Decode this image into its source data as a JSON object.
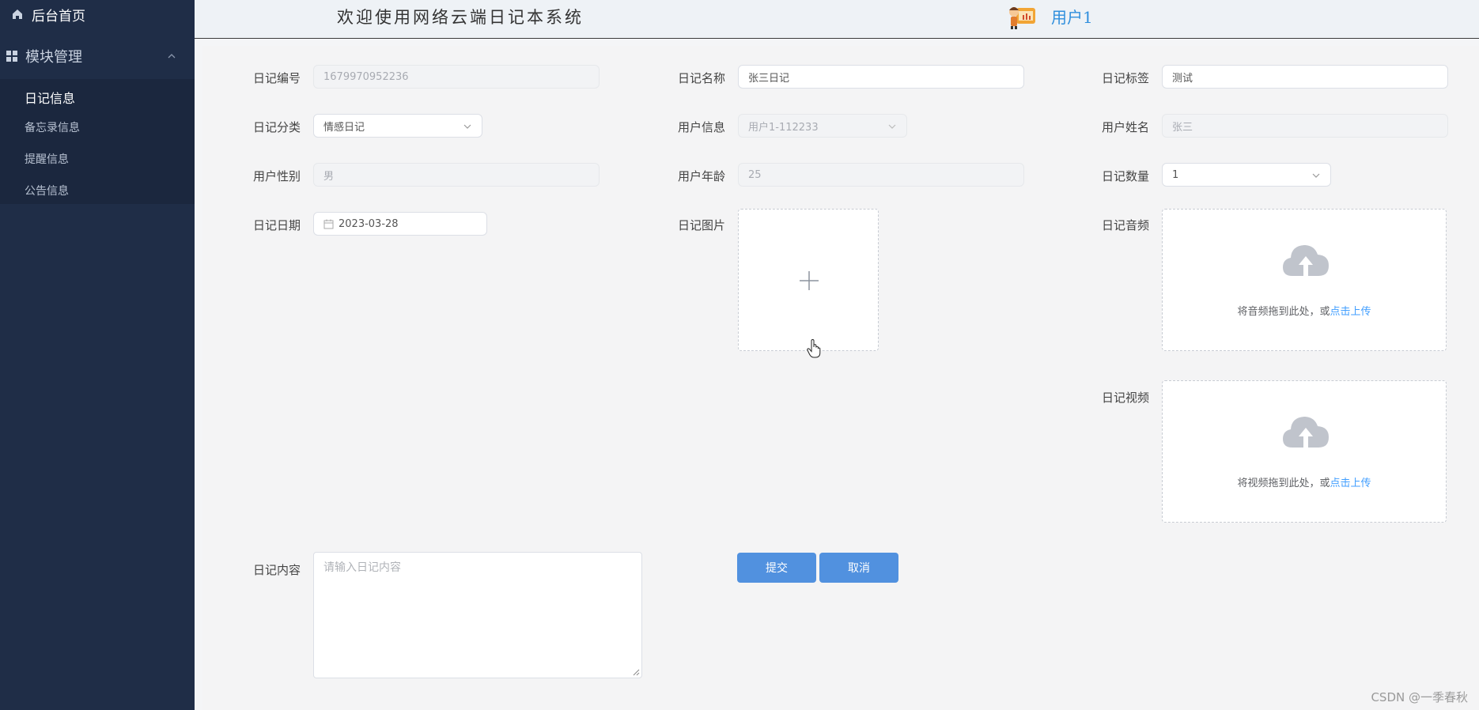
{
  "sidebar": {
    "home_label": "后台首页",
    "group_label": "模块管理",
    "items": [
      {
        "label": "日记信息",
        "active": true
      },
      {
        "label": "备忘录信息",
        "active": false
      },
      {
        "label": "提醒信息",
        "active": false
      },
      {
        "label": "公告信息",
        "active": false
      }
    ]
  },
  "header": {
    "welcome": "欢迎使用网络云端日记本系统",
    "username": "用户1"
  },
  "form": {
    "diary_no": {
      "label": "日记编号",
      "value": "1679970952236"
    },
    "diary_name": {
      "label": "日记名称",
      "value": "张三日记"
    },
    "diary_tag": {
      "label": "日记标签",
      "value": "测试"
    },
    "diary_category": {
      "label": "日记分类",
      "value": "情感日记"
    },
    "user_info": {
      "label": "用户信息",
      "value": "用户1-112233"
    },
    "user_name": {
      "label": "用户姓名",
      "value": "张三"
    },
    "user_gender": {
      "label": "用户性别",
      "value": "男"
    },
    "user_age": {
      "label": "用户年龄",
      "value": "25"
    },
    "diary_count": {
      "label": "日记数量",
      "value": "1"
    },
    "diary_date": {
      "label": "日记日期",
      "value": "2023-03-28"
    },
    "diary_image": {
      "label": "日记图片"
    },
    "diary_audio": {
      "label": "日记音频",
      "hint": "将音频拖到此处，或",
      "link": "点击上传"
    },
    "diary_video": {
      "label": "日记视频",
      "hint": "将视频拖到此处，或",
      "link": "点击上传"
    },
    "diary_content": {
      "label": "日记内容",
      "placeholder": "请输入日记内容"
    },
    "submit_label": "提交",
    "cancel_label": "取消"
  },
  "watermark": "CSDN @一季春秋",
  "colors": {
    "sidebar_bg": "#1f2d47",
    "accent": "#409eff",
    "button": "#5191df"
  }
}
